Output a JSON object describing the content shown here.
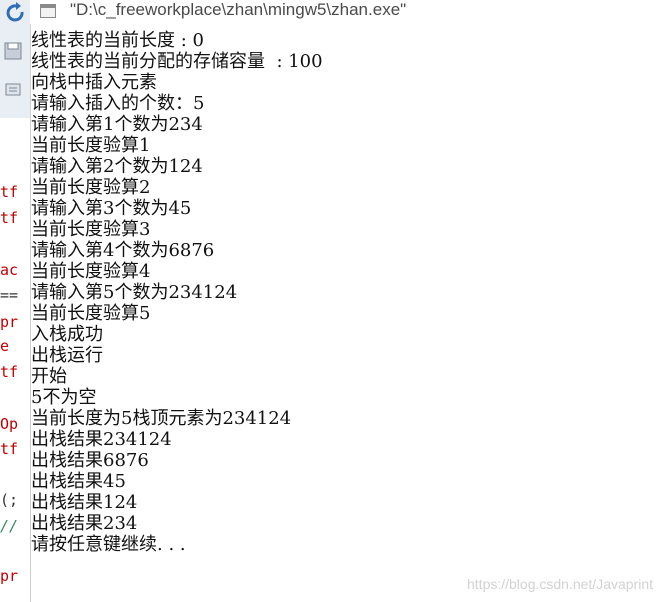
{
  "window": {
    "title": "\"D:\\c_freeworkplace\\zhan\\mingw5\\zhan.exe\""
  },
  "editor": {
    "fragments": [
      {
        "text": "tf",
        "color": "red"
      },
      {
        "text": "tf",
        "color": "red"
      },
      {
        "text": "ac",
        "color": "red"
      },
      {
        "text": "==",
        "color": "dark"
      },
      {
        "text": "pr",
        "color": "red"
      },
      {
        "text": "e",
        "color": "red"
      },
      {
        "text": "tf",
        "color": "red"
      },
      {
        "text": "Op",
        "color": "red"
      },
      {
        "text": "tf",
        "color": "red"
      },
      {
        "text": "(;",
        "color": "dark"
      },
      {
        "text": "//",
        "color": "green"
      },
      {
        "text": "pr",
        "color": "red"
      }
    ]
  },
  "console": {
    "lines": [
      "线性表的当前长度 : 0",
      "线性表的当前分配的存储容量  : 100",
      "向栈中插入元素",
      "请输入插入的个数：5",
      "请输入第1个数为234",
      "当前长度验算1",
      "请输入第2个数为124",
      "当前长度验算2",
      "请输入第3个数为45",
      "当前长度验算3",
      "请输入第4个数为6876",
      "当前长度验算4",
      "请输入第5个数为234124",
      "当前长度验算5",
      "入栈成功",
      "出栈运行",
      "开始",
      "5不为空",
      "当前长度为5栈顶元素为234124",
      "出栈结果234124",
      "出栈结果6876",
      "出栈结果45",
      "出栈结果124",
      "出栈结果234",
      "请按任意键继续. . ."
    ]
  },
  "watermark": "https://blog.csdn.net/Javaprint"
}
